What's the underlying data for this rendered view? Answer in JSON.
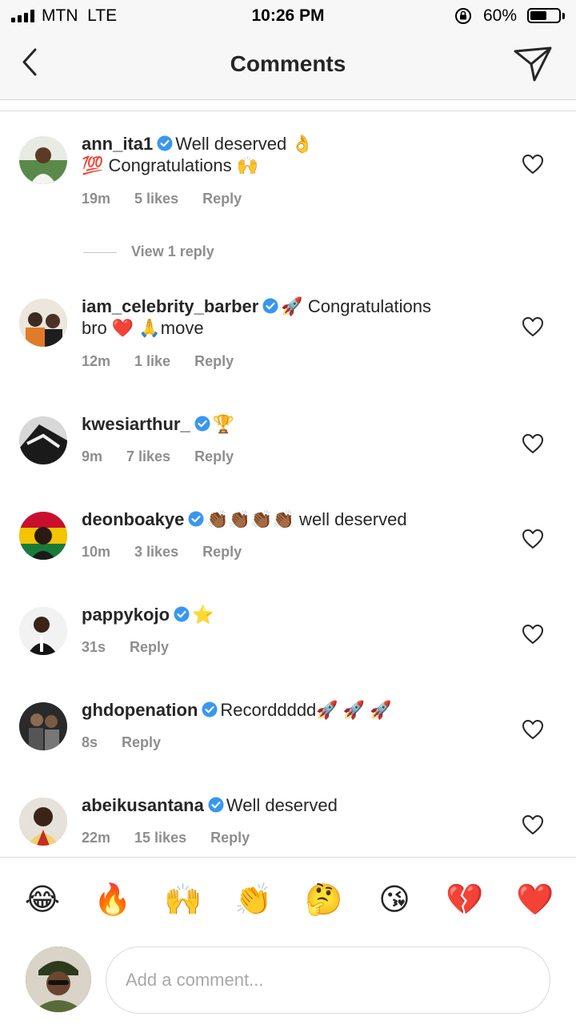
{
  "status_bar": {
    "carrier": "MTN",
    "network": "LTE",
    "time": "10:26 PM",
    "battery_percent": "60%",
    "battery_level": 0.6,
    "icons": [
      "signal-icon",
      "orientation-lock-icon",
      "battery-icon"
    ]
  },
  "header": {
    "title": "Comments",
    "icons": [
      "back-chevron-icon",
      "direct-send-icon"
    ]
  },
  "colors": {
    "verified_blue": "#3897f0",
    "meta_gray": "#8e8e8e",
    "text_dark": "#262626"
  },
  "comments": [
    {
      "username": "ann_ita1",
      "verified": true,
      "text": "Well deserved 👌",
      "text_line2": "💯 Congratulations 🙌",
      "time": "19m",
      "likes": "5 likes",
      "reply": "Reply",
      "view_replies": "View 1 reply"
    },
    {
      "username": "iam_celebrity_barber",
      "verified": true,
      "text": "🚀 Congratulations",
      "text_line2": "bro ❤️ 🙏move",
      "time": "12m",
      "likes": "1 like",
      "reply": "Reply"
    },
    {
      "username": "kwesiarthur_",
      "verified": true,
      "text": "🏆",
      "time": "9m",
      "likes": "7 likes",
      "reply": "Reply"
    },
    {
      "username": "deonboakye",
      "verified": true,
      "text": "👏🏾👏🏾👏🏾👏🏾 well deserved",
      "time": "10m",
      "likes": "3 likes",
      "reply": "Reply"
    },
    {
      "username": "pappykojo",
      "verified": true,
      "text": "⭐",
      "time": "31s",
      "likes": "",
      "reply": "Reply"
    },
    {
      "username": "ghdopenation",
      "verified": true,
      "text": "Recorddddd🚀 🚀 🚀",
      "time": "8s",
      "likes": "",
      "reply": "Reply"
    },
    {
      "username": "abeikusantana",
      "verified": true,
      "text": "Well deserved",
      "time": "22m",
      "likes": "15 likes",
      "reply": "Reply"
    }
  ],
  "emoji_bar": [
    "😂",
    "🔥",
    "🙌",
    "👏",
    "🤔",
    "😘",
    "💔",
    "❤️"
  ],
  "composer": {
    "placeholder": "Add a comment..."
  }
}
